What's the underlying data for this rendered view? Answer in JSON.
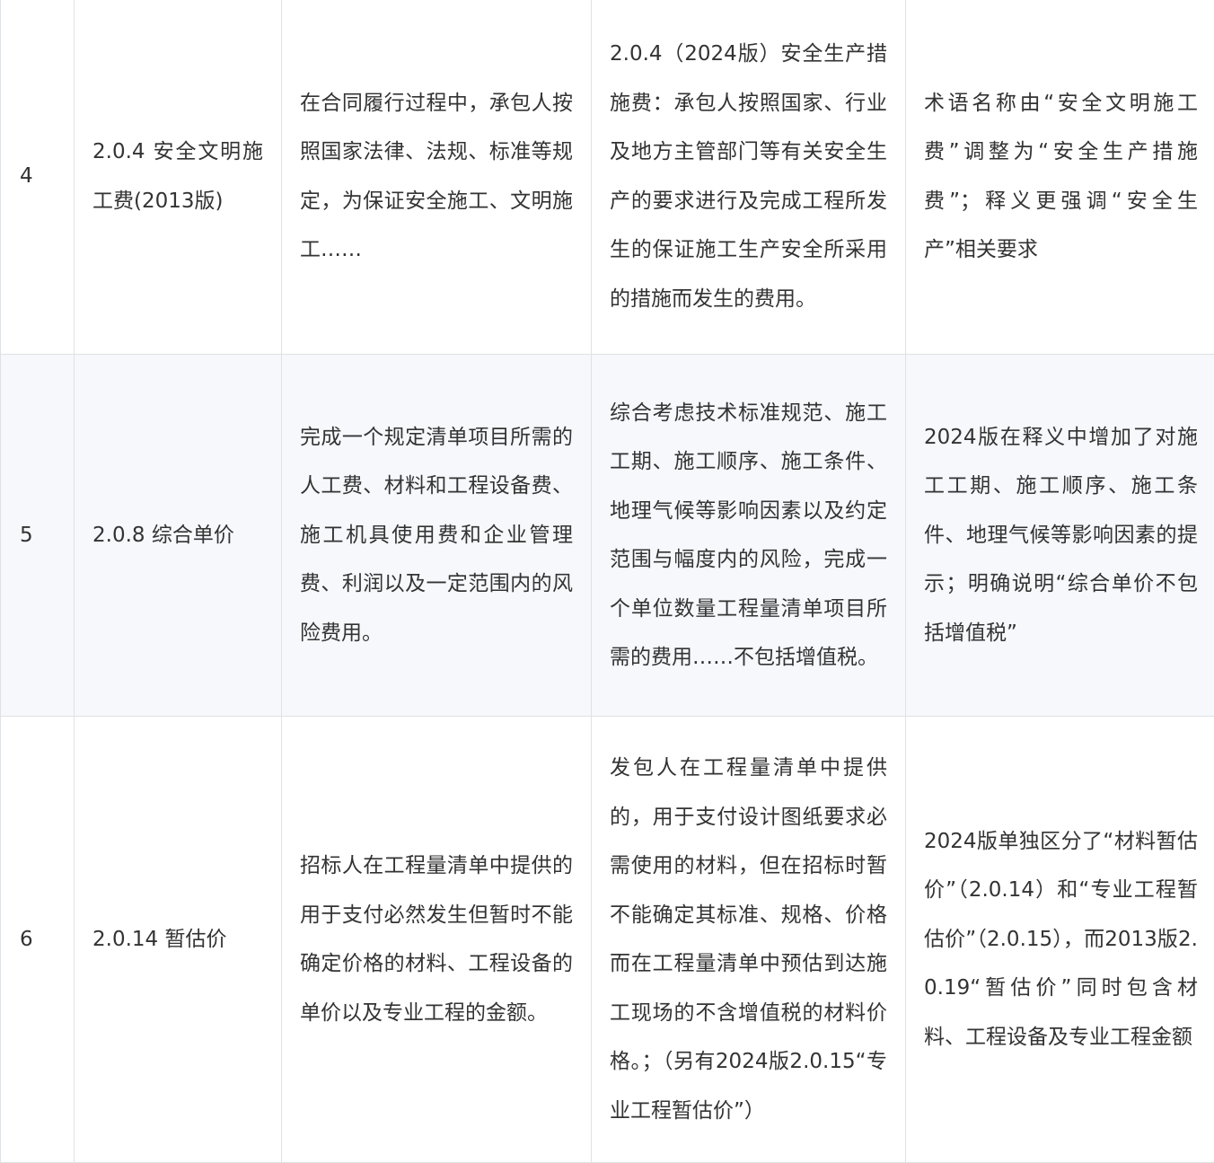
{
  "table": {
    "rows": [
      {
        "index": "4",
        "term": "2.0.4 安全文明施工费(2013版)",
        "def_2013": "在合同履行过程中，承包人按照国家法律、法规、标准等规定，为保证安全施工、文明施工……",
        "def_2024": "2.0.4（2024版）安全生产措施费：承包人按照国家、行业及地方主管部门等有关安全生产的要求进行及完成工程所发生的保证施工生产安全所采用的措施而发生的费用。",
        "change": "术语名称由“安全文明施工费”调整为“安全生产措施费”；释义更强调“安全生产”相关要求"
      },
      {
        "index": "5",
        "term": "2.0.8 综合单价",
        "def_2013": "完成一个规定清单项目所需的人工费、材料和工程设备费、施工机具使用费和企业管理费、利润以及一定范围内的风险费用。",
        "def_2024": "综合考虑技术标准规范、施工工期、施工顺序、施工条件、地理气候等影响因素以及约定范围与幅度内的风险，完成一个单位数量工程量清单项目所需的费用……不包括增值税。",
        "change": "2024版在释义中增加了对施工工期、施工顺序、施工条件、地理气候等影响因素的提示；明确说明“综合单价不包括增值税”"
      },
      {
        "index": "6",
        "term": "2.0.14 暂估价",
        "def_2013": "招标人在工程量清单中提供的用于支付必然发生但暂时不能确定价格的材料、工程设备的单价以及专业工程的金额。",
        "def_2024": "发包人在工程量清单中提供的，用于支付设计图纸要求必需使用的材料，但在招标时暂不能确定其标准、规格、价格而在工程量清单中预估到达施工现场的不含增值税的材料价格。；（另有2024版2.0.15“专业工程暂估价”）",
        "change": "2024版单独区分了“材料暂估价”（2.0.14）和“专业工程暂估价”（2.0.15），而2013版2.0.19“暂估价”同时包含材料、工程设备及专业工程金额"
      }
    ]
  }
}
